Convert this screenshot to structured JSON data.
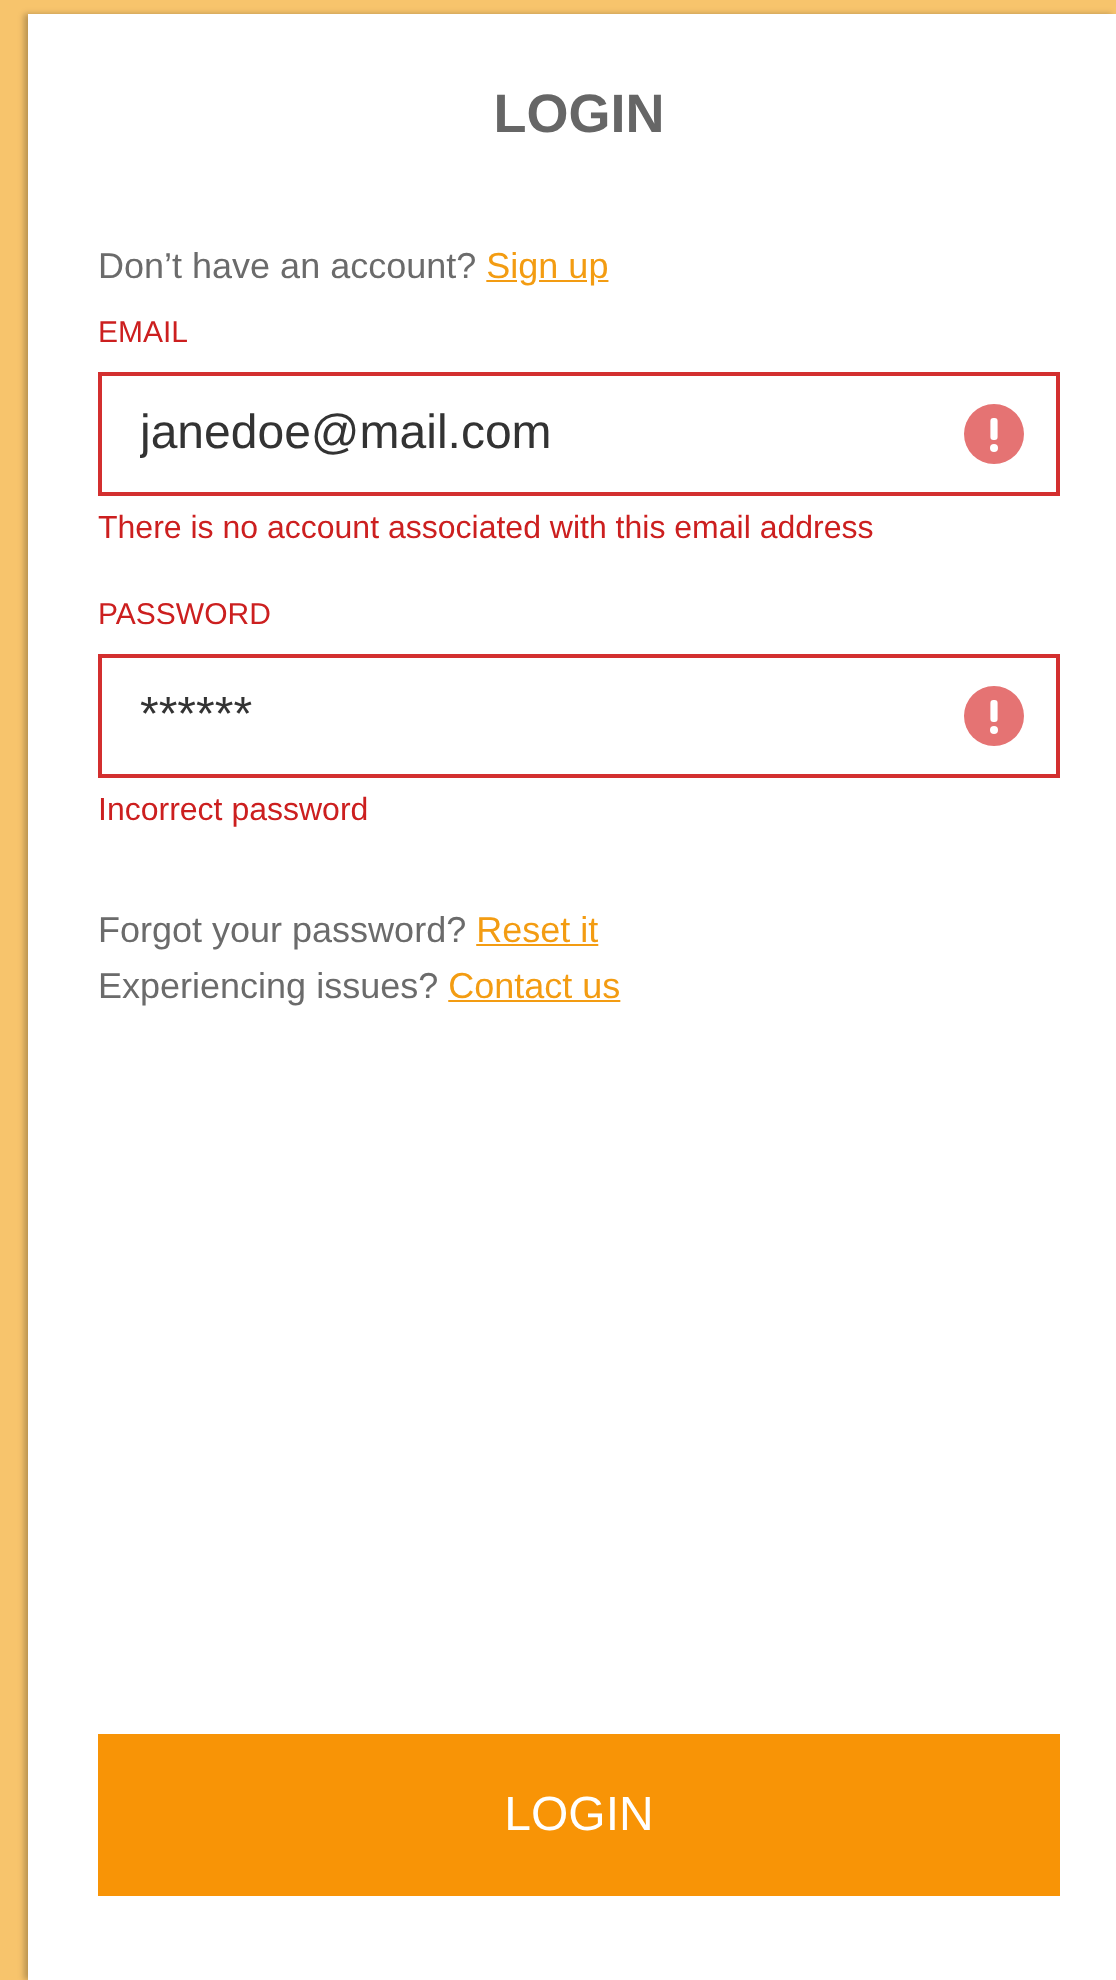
{
  "title": "LOGIN",
  "signup": {
    "prompt": "Don’t have an account?",
    "link": "Sign up"
  },
  "fields": [
    {
      "label": "EMAIL",
      "value": "janedoe@mail.com",
      "error": true,
      "error_message": "There is no account associated with this email address"
    },
    {
      "label": "PASSWORD",
      "value": "******",
      "error": true,
      "error_message": "Incorrect password"
    }
  ],
  "help_links": [
    {
      "prompt": "Forgot your password?",
      "link": "Reset it"
    },
    {
      "prompt": "Experiencing issues?",
      "link": "Contact us"
    }
  ],
  "login_button": "LOGIN"
}
